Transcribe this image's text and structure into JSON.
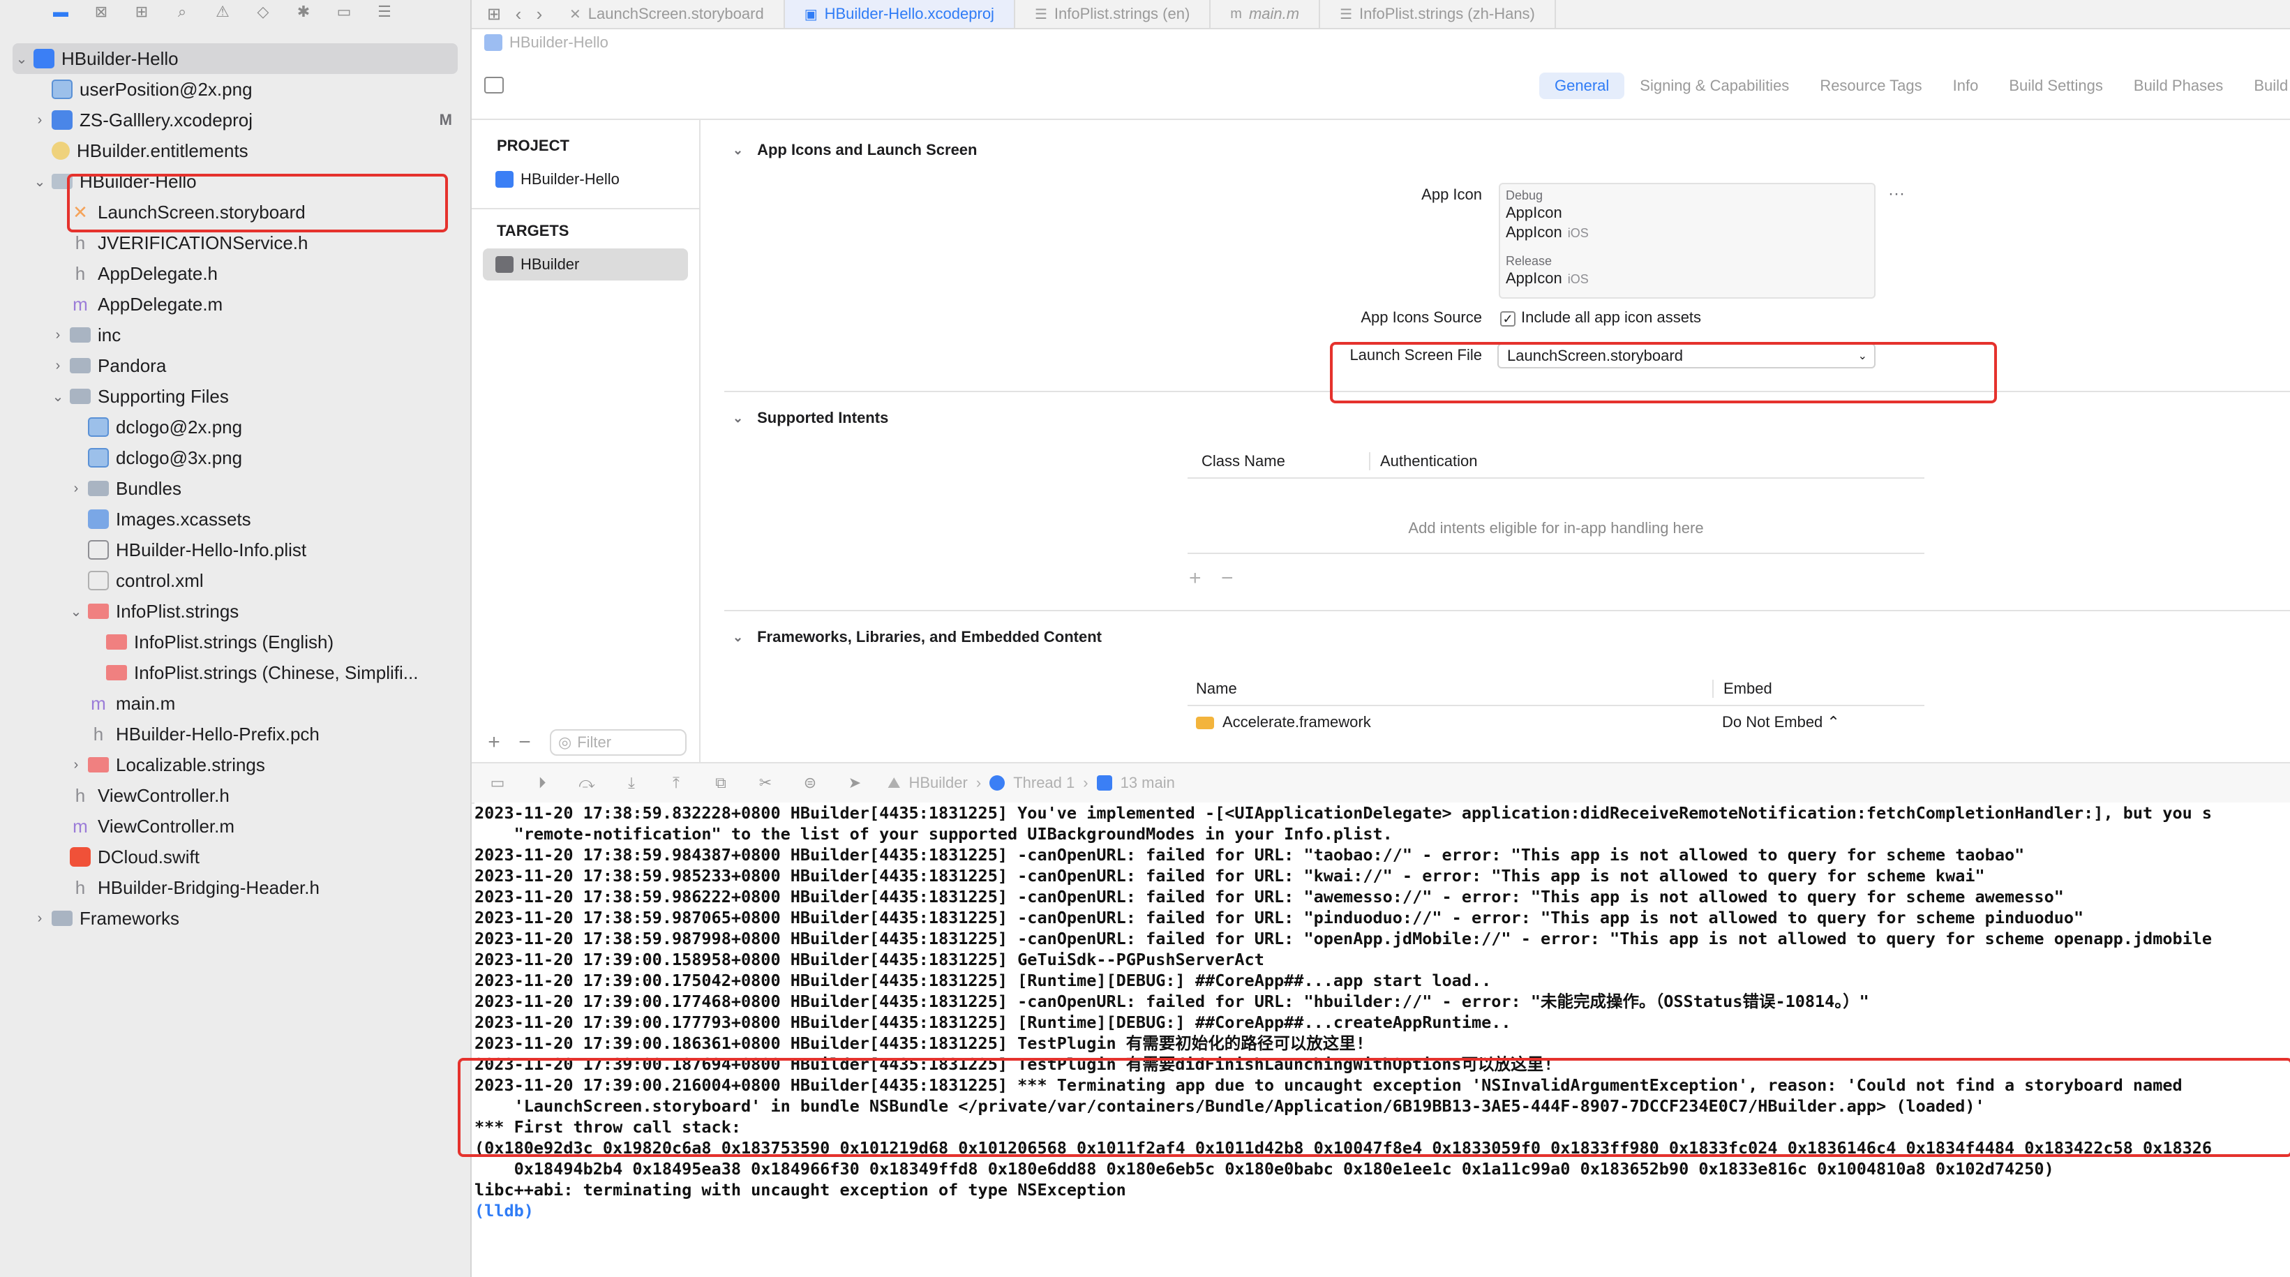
{
  "navigator": {
    "badge_m": "M",
    "items": [
      {
        "label": "HBuilder-Hello",
        "indent": 0,
        "disclosure": "open",
        "icon": "project",
        "selected": true
      },
      {
        "label": "userPosition@2x.png",
        "indent": 1,
        "disclosure": "",
        "icon": "image"
      },
      {
        "label": "ZS-Galllery.xcodeproj",
        "indent": 1,
        "disclosure": "closed",
        "icon": "xcodeproj",
        "badge": "M"
      },
      {
        "label": "HBuilder.entitlements",
        "indent": 1,
        "disclosure": "",
        "icon": "entitlements"
      },
      {
        "label": "HBuilder-Hello",
        "indent": 1,
        "disclosure": "open",
        "icon": "yfolder"
      },
      {
        "label": "LaunchScreen.storyboard",
        "indent": 2,
        "disclosure": "",
        "icon": "storyboard"
      },
      {
        "label": "JVERIFICATIONService.h",
        "indent": 2,
        "disclosure": "",
        "icon": "h"
      },
      {
        "label": "AppDelegate.h",
        "indent": 2,
        "disclosure": "",
        "icon": "h"
      },
      {
        "label": "AppDelegate.m",
        "indent": 2,
        "disclosure": "",
        "icon": "m"
      },
      {
        "label": "inc",
        "indent": 2,
        "disclosure": "closed",
        "icon": "folder"
      },
      {
        "label": "Pandora",
        "indent": 2,
        "disclosure": "closed",
        "icon": "folder"
      },
      {
        "label": "Supporting Files",
        "indent": 2,
        "disclosure": "open",
        "icon": "folder"
      },
      {
        "label": "dclogo@2x.png",
        "indent": 3,
        "disclosure": "",
        "icon": "image"
      },
      {
        "label": "dclogo@3x.png",
        "indent": 3,
        "disclosure": "",
        "icon": "image"
      },
      {
        "label": "Bundles",
        "indent": 3,
        "disclosure": "closed",
        "icon": "folder"
      },
      {
        "label": "Images.xcassets",
        "indent": 3,
        "disclosure": "",
        "icon": "assets"
      },
      {
        "label": "HBuilder-Hello-Info.plist",
        "indent": 3,
        "disclosure": "",
        "icon": "plist"
      },
      {
        "label": "control.xml",
        "indent": 3,
        "disclosure": "",
        "icon": "xml"
      },
      {
        "label": "InfoPlist.strings",
        "indent": 3,
        "disclosure": "open",
        "icon": "strings"
      },
      {
        "label": "InfoPlist.strings (English)",
        "indent": 4,
        "disclosure": "",
        "icon": "strings"
      },
      {
        "label": "InfoPlist.strings (Chinese, Simplifi...",
        "indent": 4,
        "disclosure": "",
        "icon": "strings"
      },
      {
        "label": "main.m",
        "indent": 3,
        "disclosure": "",
        "icon": "m"
      },
      {
        "label": "HBuilder-Hello-Prefix.pch",
        "indent": 3,
        "disclosure": "",
        "icon": "h"
      },
      {
        "label": "Localizable.strings",
        "indent": 3,
        "disclosure": "closed",
        "icon": "strings"
      },
      {
        "label": "ViewController.h",
        "indent": 2,
        "disclosure": "",
        "icon": "h"
      },
      {
        "label": "ViewController.m",
        "indent": 2,
        "disclosure": "",
        "icon": "m"
      },
      {
        "label": "DCloud.swift",
        "indent": 2,
        "disclosure": "",
        "icon": "swift"
      },
      {
        "label": "HBuilder-Bridging-Header.h",
        "indent": 2,
        "disclosure": "",
        "icon": "h"
      },
      {
        "label": "Frameworks",
        "indent": 1,
        "disclosure": "closed",
        "icon": "folder"
      }
    ]
  },
  "tabs": [
    {
      "label": "LaunchScreen.storyboard",
      "icon": "storyboard-icon",
      "active": false
    },
    {
      "label": "HBuilder-Hello.xcodeproj",
      "icon": "xcodeproj-icon",
      "active": true
    },
    {
      "label": "InfoPlist.strings (en)",
      "icon": "strings-icon",
      "active": false
    },
    {
      "label": "main.m",
      "icon": "m-file-icon",
      "active": false
    },
    {
      "label": "InfoPlist.strings (zh-Hans)",
      "icon": "strings-icon",
      "active": false
    }
  ],
  "breadcrumb": "HBuilder-Hello",
  "settings_tabs": [
    "General",
    "Signing & Capabilities",
    "Resource Tags",
    "Info",
    "Build Settings",
    "Build Phases",
    "Build Rules"
  ],
  "project_list": {
    "project_header": "PROJECT",
    "project_item": "HBuilder-Hello",
    "targets_header": "TARGETS",
    "target_item": "HBuilder",
    "filter_placeholder": "Filter"
  },
  "general": {
    "app_icons_section": "App Icons and Launch Screen",
    "app_icon_label": "App Icon",
    "debug_caption": "Debug",
    "debug_value_1": "AppIcon",
    "debug_value_2": "AppIcon",
    "ios_tag": "iOS",
    "release_caption": "Release",
    "release_value": "AppIcon",
    "app_icons_source_label": "App Icons Source",
    "include_all_label": "Include all app icon assets",
    "launch_screen_label": "Launch Screen File",
    "launch_screen_value": "LaunchScreen.storyboard",
    "supported_intents_section": "Supported Intents",
    "col_class_name": "Class Name",
    "col_authentication": "Authentication",
    "intents_empty": "Add intents eligible for in-app handling here",
    "frameworks_section": "Frameworks, Libraries, and Embedded Content",
    "col_name": "Name",
    "col_embed": "Embed",
    "framework_name": "Accelerate.framework",
    "framework_embed": "Do Not Embed ⌃"
  },
  "debugbar": {
    "scheme": "HBuilder",
    "thread": "Thread 1",
    "frame": "13 main"
  },
  "console": {
    "lines": [
      "2023-11-20 17:38:59.832228+0800 HBuilder[4435:1831225] You've implemented -[<UIApplicationDelegate> application:didReceiveRemoteNotification:fetchCompletionHandler:], but you s",
      "    \"remote-notification\" to the list of your supported UIBackgroundModes in your Info.plist.",
      "2023-11-20 17:38:59.984387+0800 HBuilder[4435:1831225] -canOpenURL: failed for URL: \"taobao://\" - error: \"This app is not allowed to query for scheme taobao\"",
      "2023-11-20 17:38:59.985233+0800 HBuilder[4435:1831225] -canOpenURL: failed for URL: \"kwai://\" - error: \"This app is not allowed to query for scheme kwai\"",
      "2023-11-20 17:38:59.986222+0800 HBuilder[4435:1831225] -canOpenURL: failed for URL: \"awemesso://\" - error: \"This app is not allowed to query for scheme awemesso\"",
      "2023-11-20 17:38:59.987065+0800 HBuilder[4435:1831225] -canOpenURL: failed for URL: \"pinduoduo://\" - error: \"This app is not allowed to query for scheme pinduoduo\"",
      "2023-11-20 17:38:59.987998+0800 HBuilder[4435:1831225] -canOpenURL: failed for URL: \"openApp.jdMobile://\" - error: \"This app is not allowed to query for scheme openapp.jdmobile",
      "2023-11-20 17:39:00.158958+0800 HBuilder[4435:1831225] GeTuiSdk--PGPushServerAct",
      "2023-11-20 17:39:00.175042+0800 HBuilder[4435:1831225] [Runtime][DEBUG:] ##CoreApp##...app start load..",
      "2023-11-20 17:39:00.177468+0800 HBuilder[4435:1831225] -canOpenURL: failed for URL: \"hbuilder://\" - error: \"未能完成操作。（OSStatus错误-10814。）\"",
      "2023-11-20 17:39:00.177793+0800 HBuilder[4435:1831225] [Runtime][DEBUG:] ##CoreApp##...createAppRuntime..",
      "2023-11-20 17:39:00.186361+0800 HBuilder[4435:1831225] TestPlugin 有需要初始化的路径可以放这里!",
      "2023-11-20 17:39:00.187694+0800 HBuilder[4435:1831225] TestPlugin 有需要didFinishLaunchingWithOptions可以放这里!",
      "2023-11-20 17:39:00.216004+0800 HBuilder[4435:1831225] *** Terminating app due to uncaught exception 'NSInvalidArgumentException', reason: 'Could not find a storyboard named",
      "    'LaunchScreen.storyboard' in bundle NSBundle </private/var/containers/Bundle/Application/6B19BB13-3AE5-444F-8907-7DCCF234E0C7/HBuilder.app> (loaded)'",
      "*** First throw call stack:",
      "(0x180e92d3c 0x19820c6a8 0x183753590 0x101219d68 0x101206568 0x1011f2af4 0x1011d42b8 0x10047f8e4 0x1833059f0 0x1833ff980 0x1833fc024 0x1836146c4 0x1834f4484 0x183422c58 0x18326",
      "    0x18494b2b4 0x18495ea38 0x184966f30 0x18349ffd8 0x180e6dd88 0x180e6eb5c 0x180e0babc 0x180e1ee1c 0x1a11c99a0 0x183652b90 0x1833e816c 0x1004810a8 0x102d74250)",
      "libc++abi: terminating with uncaught exception of type NSException"
    ],
    "prompt": "(lldb)"
  },
  "colors": {
    "accent": "#2f7cf6",
    "highlight": "#e5322d"
  }
}
